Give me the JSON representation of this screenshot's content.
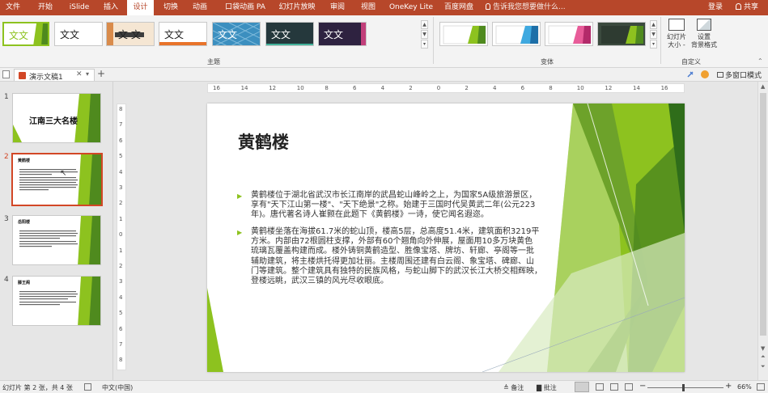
{
  "menu": {
    "items": [
      "文件",
      "开始",
      "iSlide",
      "插入",
      "设计",
      "切换",
      "动画",
      "口袋动画 PA",
      "幻灯片放映",
      "审阅",
      "视图",
      "OneKey Lite",
      "百度网盘"
    ],
    "active": "设计",
    "tellme": "告诉我您想要做什么...",
    "login": "登录",
    "share": "共享"
  },
  "ribbon": {
    "themes_label": "主题",
    "variants_label": "变体",
    "customize_label": "自定义",
    "theme_text": "文文",
    "theme_text_a": "文文",
    "theme_text_b": "文 文",
    "slide_size_label": "幻灯片\n大小",
    "slide_size_l1": "幻灯片",
    "slide_size_l2": "大小 -",
    "bg_format_l1": "设置",
    "bg_format_l2": "背景格式"
  },
  "tabs": {
    "doc_tab": "演示文稿1",
    "add": "+",
    "multiwindow": "多窗口模式"
  },
  "thumbnails": [
    {
      "num": "1",
      "title": "江南三大名楼"
    },
    {
      "num": "2",
      "title": "黄鹤楼"
    },
    {
      "num": "3",
      "title": "岳阳楼"
    },
    {
      "num": "4",
      "title": "滕王阁"
    }
  ],
  "ruler_h_labels": [
    "16",
    "14",
    "12",
    "10",
    "8",
    "6",
    "4",
    "2",
    "0",
    "2",
    "4",
    "6",
    "8",
    "10",
    "12",
    "14",
    "16"
  ],
  "ruler_v_labels": [
    "8",
    "7",
    "6",
    "5",
    "4",
    "3",
    "2",
    "1",
    "0",
    "1",
    "2",
    "3",
    "4",
    "5",
    "6",
    "7",
    "8"
  ],
  "slide": {
    "title": "黄鹤楼",
    "p1_lines": [
      "黄鹤楼位于湖北省武汉市长江南岸的武昌蛇山峰岭之上，为国家5A级旅游景区，",
      "享有\"天下江山第一楼\"、\"天下绝景\"之称。始建于三国时代吴黄武二年(公元223",
      "年)。唐代著名诗人崔颢在此题下《黄鹤楼》一诗，使它闻名遐迩。"
    ],
    "p2_lines": [
      "黄鹤楼坐落在海拔61.7米的蛇山顶，楼高5层，总高度51.4米，建筑面积3219平",
      "方米。内部由72根圆柱支撑，外部有60个翘角向外伸展，屋面用10多万块黄色",
      "琉璃瓦覆盖构建而成。楼外铸铜黄鹤造型、胜像宝塔、牌坊、轩廊、亭阁等一批",
      "辅助建筑，将主楼烘托得更加壮丽。主楼周围还建有白云阁、象宝塔、碑廊、山",
      "门等建筑。整个建筑具有独特的民族风格，与蛇山脚下的武汉长江大桥交相辉映，",
      "登楼远眺，武汉三镇的风光尽收眼底。"
    ]
  },
  "status": {
    "slide_info": "幻灯片 第 2 张，共 4 张",
    "language": "中文(中国)",
    "notes": "备注",
    "comments": "批注",
    "zoom": "66%"
  },
  "colors": {
    "accent": "#b7472a",
    "green": "#8dc21f",
    "dark_green": "#4f8a1e",
    "selected_border": "#d24726"
  }
}
